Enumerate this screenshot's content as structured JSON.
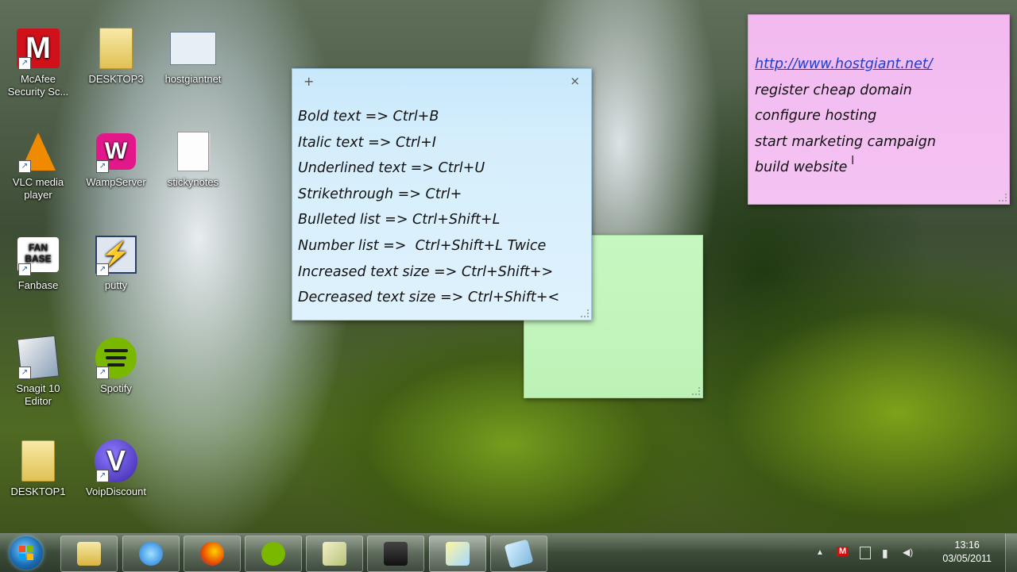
{
  "desktop": {
    "icons": [
      {
        "id": "mcafee",
        "label": "McAfee Security Sc...",
        "icon": "mcafee-logo-icon"
      },
      {
        "id": "desktop3",
        "label": "DESKTOP3",
        "icon": "folder-icon"
      },
      {
        "id": "hostgiantnet",
        "label": "hostgiantnet",
        "icon": "webpage-thumbnail-icon"
      },
      {
        "id": "vlc",
        "label": "VLC media player",
        "icon": "vlc-cone-icon"
      },
      {
        "id": "wampserver",
        "label": "WampServer",
        "icon": "wampserver-icon"
      },
      {
        "id": "stickynotes",
        "label": "stickynotes",
        "icon": "text-document-icon"
      },
      {
        "id": "fanbase",
        "label": "Fanbase",
        "icon": "fanbase-icon"
      },
      {
        "id": "putty",
        "label": "putty",
        "icon": "putty-icon"
      },
      {
        "id": "snagit",
        "label": "Snagit 10 Editor",
        "icon": "snagit-icon"
      },
      {
        "id": "spotify",
        "label": "Spotify",
        "icon": "spotify-icon"
      },
      {
        "id": "desktop1",
        "label": "DESKTOP1",
        "icon": "folder-icon"
      },
      {
        "id": "voipdiscount",
        "label": "VoipDiscount",
        "icon": "voipdiscount-icon"
      }
    ],
    "icon_glyphs": {
      "mcafee": "M",
      "wamp": "W",
      "fanbase": "FAN BASE",
      "putty": "⚡",
      "voip": "V",
      "shortcut": "↗"
    }
  },
  "sticky_blue": {
    "add": "+",
    "close": "×",
    "lines": [
      "Bold text => Ctrl+B",
      "Italic text => Ctrl+I",
      "Underlined text => Ctrl+U",
      "Strikethrough => Ctrl+",
      "Bulleted list => Ctrl+Shift+L",
      "Number list =>  Ctrl+Shift+L Twice",
      "Increased text size => Ctrl+Shift+>",
      "Decreased text size => Ctrl+Shift+<"
    ]
  },
  "sticky_pink": {
    "lines": [
      "http://www.hostgiant.net/",
      "register cheap domain",
      "configure hosting",
      "start marketing campaign",
      "build website"
    ]
  },
  "taskbar": {
    "buttons": [
      {
        "name": "windows-explorer",
        "icon": "folder-icon"
      },
      {
        "name": "internet-explorer",
        "icon": "internet-explorer-icon"
      },
      {
        "name": "firefox",
        "icon": "firefox-icon"
      },
      {
        "name": "spotify",
        "icon": "spotify-icon"
      },
      {
        "name": "notes-app",
        "icon": "notepad-icon"
      },
      {
        "name": "camera-app",
        "icon": "camcorder-icon"
      },
      {
        "name": "sticky-notes",
        "icon": "sticky-notes-icon"
      },
      {
        "name": "paint-app",
        "icon": "eraser-icon"
      }
    ],
    "tray": {
      "arrow": "▲",
      "mcafee": "M",
      "network": "▮",
      "volume": "◀)"
    },
    "clock": {
      "time": "13:16",
      "date": "03/05/2011"
    }
  },
  "colors": {
    "sticky_blue": "#d5eefc",
    "sticky_green": "#c7f7c1",
    "sticky_pink": "#f4c3f2",
    "link": "#1f3ec7"
  }
}
